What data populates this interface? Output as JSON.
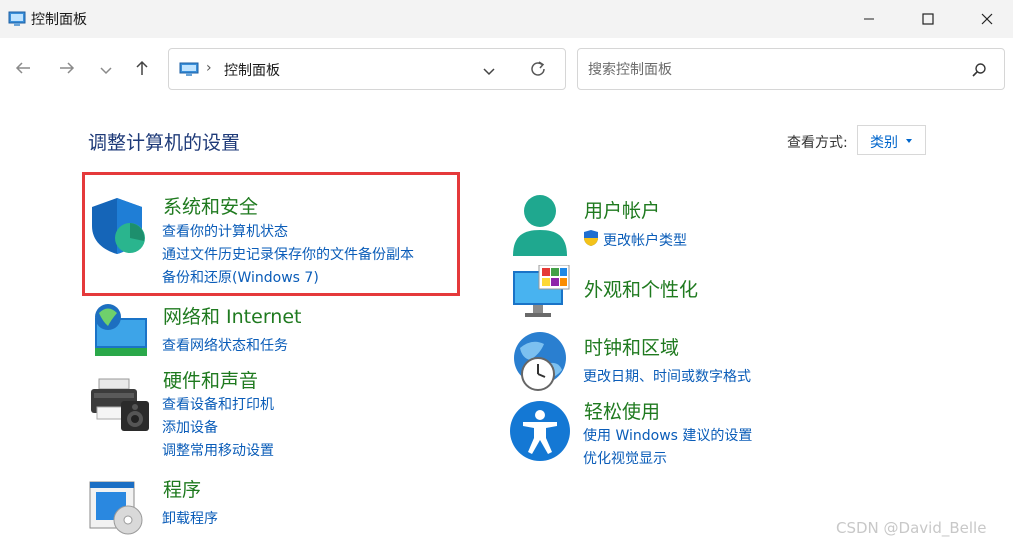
{
  "window": {
    "title": "控制面板"
  },
  "nav": {
    "breadcrumb": "控制面板",
    "search_placeholder": "搜索控制面板"
  },
  "main": {
    "heading": "调整计算机的设置",
    "view_by_label": "查看方式:",
    "view_by_value": "类别"
  },
  "categories": [
    {
      "title": "系统和安全",
      "links": [
        "查看你的计算机状态",
        "通过文件历史记录保存你的文件备份副本",
        "备份和还原(Windows 7)"
      ]
    },
    {
      "title": "网络和 Internet",
      "links": [
        "查看网络状态和任务"
      ]
    },
    {
      "title": "硬件和声音",
      "links": [
        "查看设备和打印机",
        "添加设备",
        "调整常用移动设置"
      ]
    },
    {
      "title": "程序",
      "links": [
        "卸载程序"
      ]
    },
    {
      "title": "用户帐户",
      "links": [
        "更改帐户类型"
      ]
    },
    {
      "title": "外观和个性化",
      "links": []
    },
    {
      "title": "时钟和区域",
      "links": [
        "更改日期、时间或数字格式"
      ]
    },
    {
      "title": "轻松使用",
      "links": [
        "使用 Windows 建议的设置",
        "优化视觉显示"
      ]
    }
  ],
  "colors": {
    "category_title": "#1f7a1f",
    "link": "#0a5cb8",
    "heading": "#1e3a78",
    "highlight_box": "#e5393b"
  },
  "icons": [
    "control-panel-icon",
    "back-arrow-icon",
    "forward-arrow-icon",
    "chevron-down-icon",
    "up-arrow-icon",
    "refresh-icon",
    "search-icon",
    "shield-icon",
    "network-icon",
    "printer-icon",
    "programs-icon",
    "user-icon",
    "uac-shield-icon",
    "monitor-icon",
    "clock-globe-icon",
    "accessibility-icon"
  ],
  "watermark": "CSDN @David_Belle"
}
